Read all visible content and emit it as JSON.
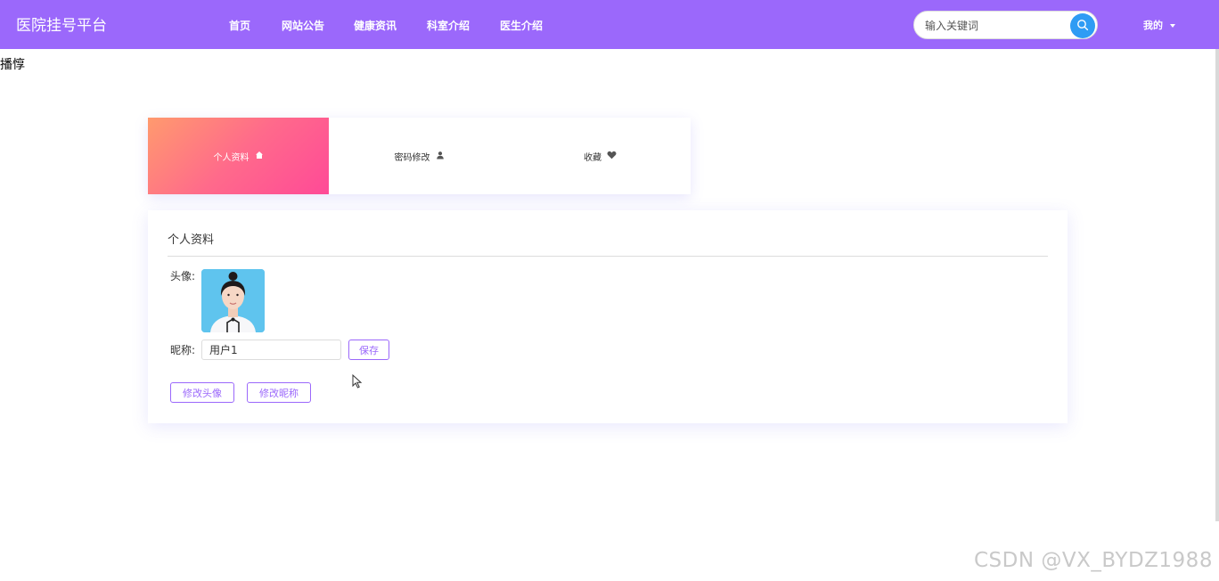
{
  "nav": {
    "brand": "医院挂号平台",
    "links": [
      "首页",
      "网站公告",
      "健康资讯",
      "科室介绍",
      "医生介绍"
    ],
    "search_placeholder": "输入关键词",
    "me_label": "我的",
    "bg_color": "#9b68fb",
    "search_icon": "search-icon"
  },
  "stray_text": "播惇",
  "tabs": [
    {
      "label": "个人资料",
      "icon": "home-icon",
      "active": true
    },
    {
      "label": "密码修改",
      "icon": "user-icon",
      "active": false
    },
    {
      "label": "收藏",
      "icon": "heart-icon",
      "active": false
    }
  ],
  "profile": {
    "title": "个人资料",
    "avatar_label": "头像:",
    "nickname_label": "昵称:",
    "nickname_value": "用户1",
    "save_label": "保存",
    "change_avatar_label": "修改头像",
    "change_nickname_label": "修改昵称",
    "accent_color": "#9b68fb"
  },
  "watermark": "CSDN @VX_BYDZ1988"
}
